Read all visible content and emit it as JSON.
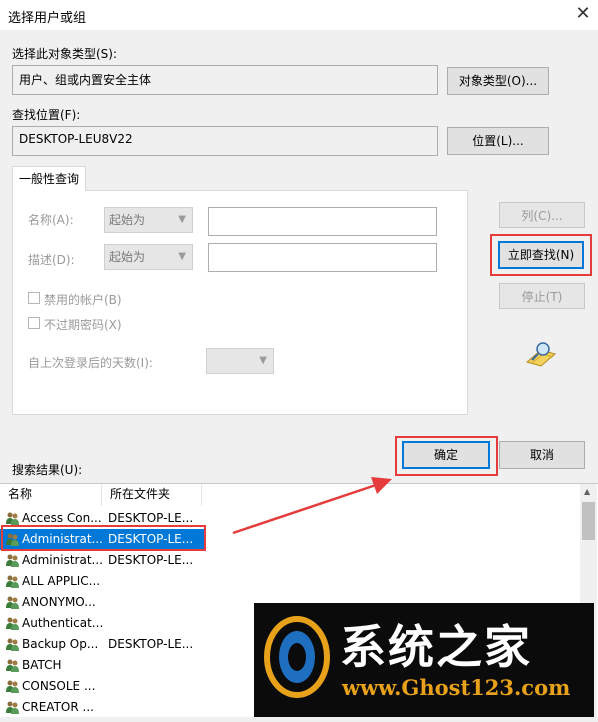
{
  "window": {
    "title": "选择用户或组",
    "close_glyph": "✕"
  },
  "object_type": {
    "label": "选择此对象类型(S):",
    "value": "用户、组或内置安全主体",
    "button": "对象类型(O)..."
  },
  "location": {
    "label": "查找位置(F):",
    "value": "DESKTOP-LEU8V22",
    "button": "位置(L)..."
  },
  "query_tab": {
    "label": "一般性查询"
  },
  "form": {
    "name_label": "名称(A):",
    "name_mode": "起始为",
    "desc_label": "描述(D):",
    "desc_mode": "起始为",
    "disabled_accounts": "禁用的帐户(B)",
    "non_expiring_pw": "不过期密码(X)",
    "days_since_login": "自上次登录后的天数(I):"
  },
  "side_buttons": {
    "columns": "列(C)...",
    "find_now": "立即查找(N)",
    "stop": "停止(T)"
  },
  "dialog_buttons": {
    "ok": "确定",
    "cancel": "取消"
  },
  "results": {
    "label": "搜索结果(U):",
    "columns": [
      "名称",
      "所在文件夹"
    ],
    "rows": [
      {
        "name": "Access Con...",
        "folder": "DESKTOP-LE..."
      },
      {
        "name": "Administrat...",
        "folder": "DESKTOP-LE..."
      },
      {
        "name": "Administrat...",
        "folder": "DESKTOP-LE..."
      },
      {
        "name": "ALL APPLIC...",
        "folder": ""
      },
      {
        "name": "ANONYMO...",
        "folder": ""
      },
      {
        "name": "Authenticat...",
        "folder": ""
      },
      {
        "name": "Backup Op...",
        "folder": "DESKTOP-LE..."
      },
      {
        "name": "BATCH",
        "folder": ""
      },
      {
        "name": "CONSOLE ...",
        "folder": ""
      },
      {
        "name": "CREATOR ...",
        "folder": ""
      }
    ],
    "selected_index": 1
  },
  "watermark": {
    "brand": "系统之家",
    "url": "www.Ghost123.com"
  },
  "colors": {
    "accent": "#0078d7",
    "highlight_red": "#e53b3b",
    "watermark_orange": "#e8a21a"
  }
}
